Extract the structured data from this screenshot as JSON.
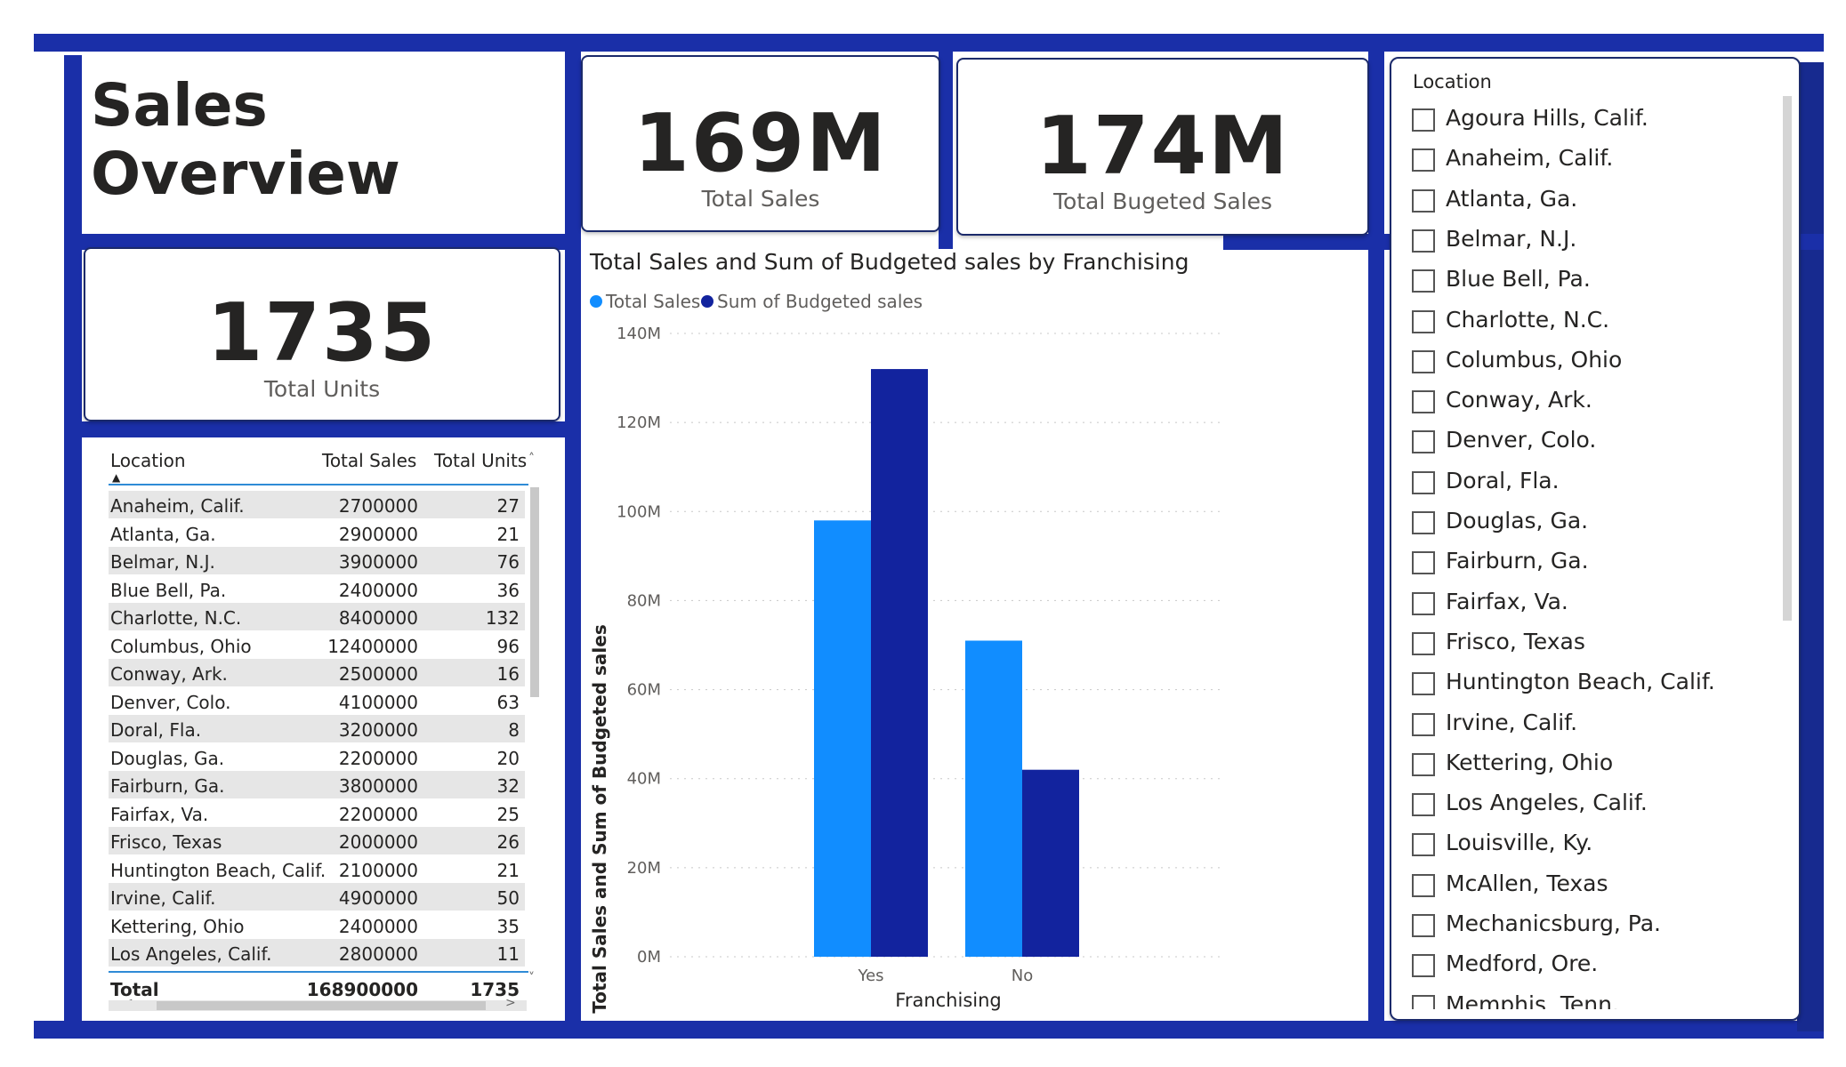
{
  "colors": {
    "frame": "#1a2fa8",
    "series_total": "#118dff",
    "series_budget": "#12239e"
  },
  "title": "Sales Overview",
  "kpis": {
    "total_sales": {
      "value": "169M",
      "label": "Total Sales"
    },
    "total_budgeted": {
      "value": "174M",
      "label": "Total Bugeted Sales"
    },
    "total_units": {
      "value": "1735",
      "label": "Total Units"
    }
  },
  "table": {
    "headers": [
      "Location",
      "Total Sales",
      "Total Units"
    ],
    "rows": [
      [
        "Anaheim, Calif.",
        "2700000",
        "27"
      ],
      [
        "Atlanta, Ga.",
        "2900000",
        "21"
      ],
      [
        "Belmar, N.J.",
        "3900000",
        "76"
      ],
      [
        "Blue Bell, Pa.",
        "2400000",
        "36"
      ],
      [
        "Charlotte, N.C.",
        "8400000",
        "132"
      ],
      [
        "Columbus, Ohio",
        "12400000",
        "96"
      ],
      [
        "Conway, Ark.",
        "2500000",
        "16"
      ],
      [
        "Denver, Colo.",
        "4100000",
        "63"
      ],
      [
        "Doral, Fla.",
        "3200000",
        "8"
      ],
      [
        "Douglas, Ga.",
        "2200000",
        "20"
      ],
      [
        "Fairburn, Ga.",
        "3800000",
        "32"
      ],
      [
        "Fairfax, Va.",
        "2200000",
        "25"
      ],
      [
        "Frisco, Texas",
        "2000000",
        "26"
      ],
      [
        "Huntington Beach, Calif.",
        "2100000",
        "21"
      ],
      [
        "Irvine, Calif.",
        "4900000",
        "50"
      ],
      [
        "Kettering, Ohio",
        "2400000",
        "35"
      ],
      [
        "Los Angeles, Calif.",
        "2800000",
        "11"
      ]
    ],
    "total": [
      "Total",
      "168900000",
      "1735"
    ]
  },
  "chart_data": {
    "type": "bar",
    "title": "Total Sales and Sum of Budgeted sales by Franchising",
    "categories": [
      "Yes",
      "No"
    ],
    "series": [
      {
        "name": "Total Sales",
        "values": [
          98,
          71
        ]
      },
      {
        "name": "Sum of Budgeted sales",
        "values": [
          132,
          42
        ]
      }
    ],
    "xlabel": "Franchising",
    "ylabel": "Total Sales and Sum of Budgeted sales",
    "ylim": [
      0,
      140
    ],
    "yticks": [
      "0M",
      "20M",
      "40M",
      "60M",
      "80M",
      "100M",
      "120M",
      "140M"
    ],
    "grid": true,
    "legend": "top-left"
  },
  "slicer": {
    "title": "Location",
    "items": [
      "Agoura Hills, Calif.",
      "Anaheim, Calif.",
      "Atlanta, Ga.",
      "Belmar, N.J.",
      "Blue Bell, Pa.",
      "Charlotte, N.C.",
      "Columbus, Ohio",
      "Conway, Ark.",
      "Denver, Colo.",
      "Doral, Fla.",
      "Douglas, Ga.",
      "Fairburn, Ga.",
      "Fairfax, Va.",
      "Frisco, Texas",
      "Huntington Beach, Calif.",
      "Irvine, Calif.",
      "Kettering, Ohio",
      "Los Angeles, Calif.",
      "Louisville, Ky.",
      "McAllen, Texas",
      "Mechanicsburg, Pa.",
      "Medford, Ore.",
      "Memphis, Tenn."
    ]
  }
}
